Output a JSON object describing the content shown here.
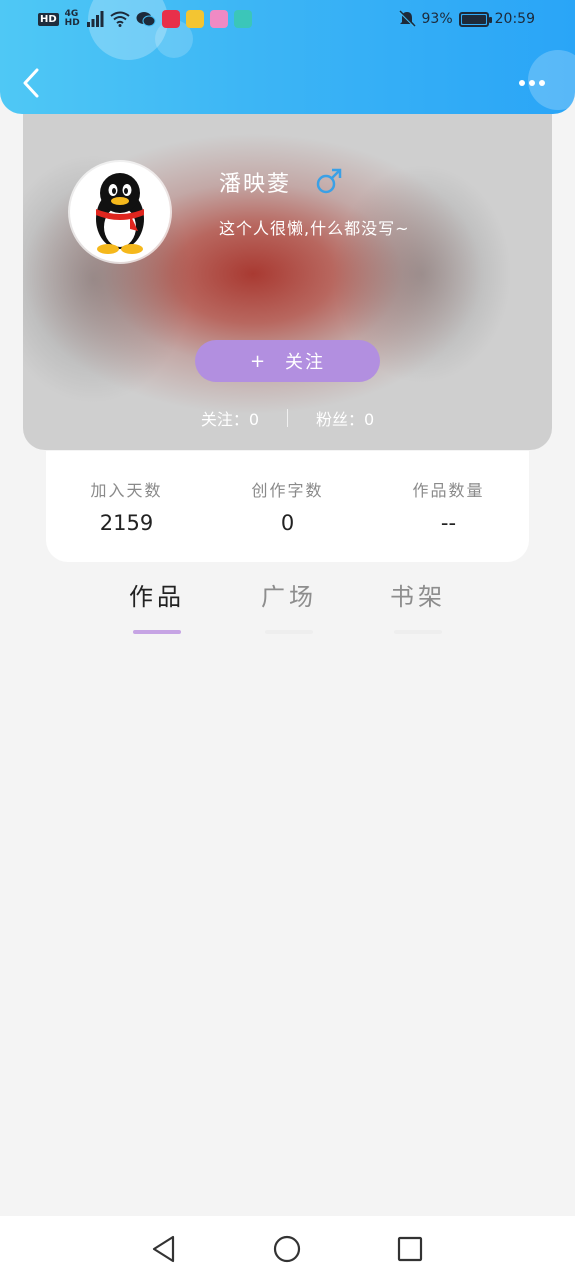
{
  "status_bar": {
    "network_hd": "HD",
    "network_4g": "4G",
    "network_hd2": "HD",
    "battery_percent": "93%",
    "battery_level": 0.93,
    "time": "20:59",
    "icons": [
      "signal-icon",
      "wifi-icon",
      "wechat-icon",
      "xiaohongshu-icon",
      "weibo-icon",
      "app-icon",
      "book-app-icon",
      "mute-bell-icon",
      "battery-icon"
    ]
  },
  "header": {
    "back_icon": "chevron-left-icon",
    "more_icon": "more-dots-icon",
    "gradient_start": "#4fc8f5",
    "gradient_end": "#2aa5f7"
  },
  "profile": {
    "username": "潘映菱",
    "gender_symbol": "♂",
    "gender_color": "#3aa0e6",
    "bio": "这个人很懒,什么都没写~",
    "follow_button": {
      "plus": "+",
      "label": "关注"
    },
    "following": "关注：0",
    "followers": "粉丝：0",
    "accent": "#b28fe0"
  },
  "stats": [
    {
      "label": "加入天数",
      "value": "2159"
    },
    {
      "label": "创作字数",
      "value": "0"
    },
    {
      "label": "作品数量",
      "value": "--"
    }
  ],
  "tabs": [
    {
      "label": "作品",
      "active": true
    },
    {
      "label": "广场",
      "active": false
    },
    {
      "label": "书架",
      "active": false
    }
  ],
  "nav_bar": {
    "buttons": [
      "nav-back-icon",
      "nav-home-icon",
      "nav-recent-icon"
    ]
  }
}
